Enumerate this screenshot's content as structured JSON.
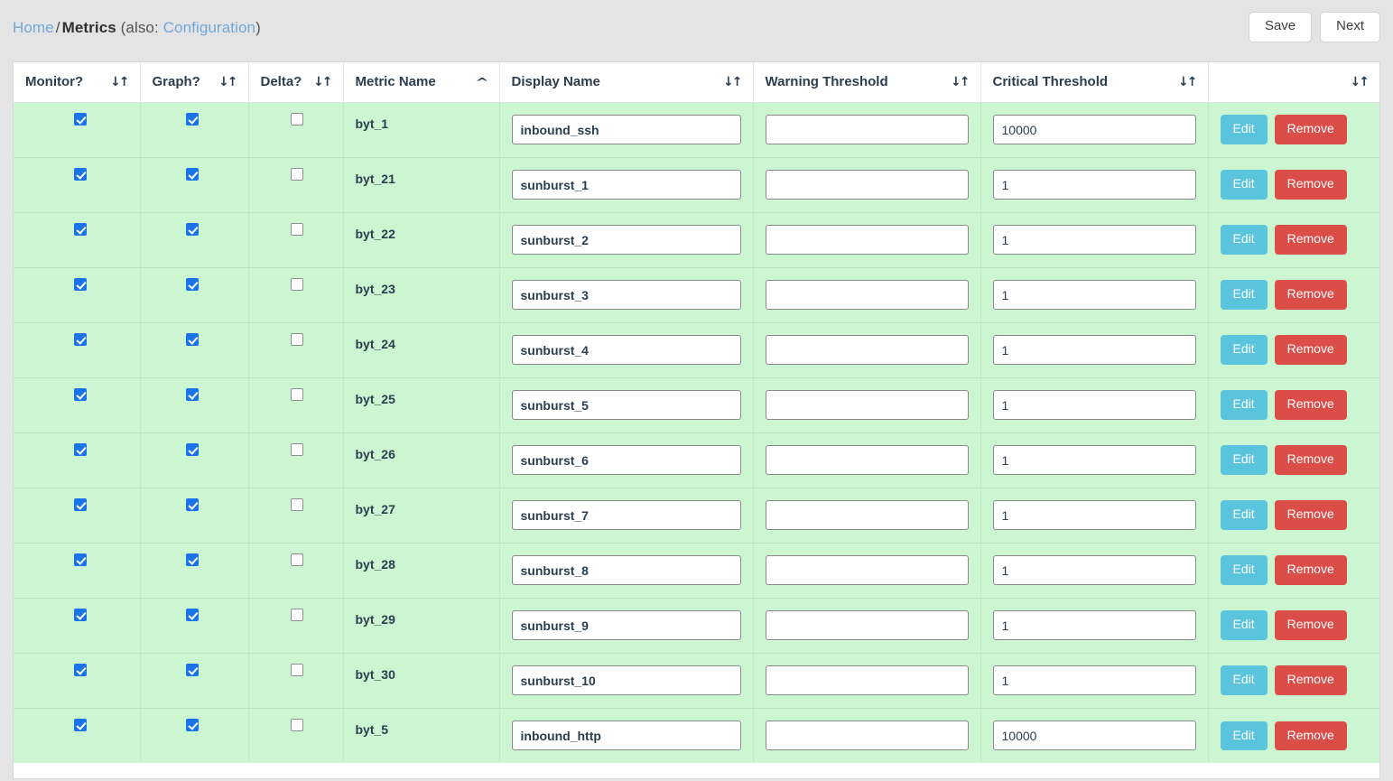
{
  "breadcrumb": {
    "home": "Home",
    "separator": "/",
    "current": "Metrics",
    "note_open": "(also:",
    "config_link": "Configuration",
    "note_close": ")"
  },
  "toolbar": {
    "save_label": "Save",
    "next_label": "Next"
  },
  "table": {
    "columns": [
      {
        "label": "Monitor?",
        "sort_icon": "↓↑",
        "sorted": false
      },
      {
        "label": "Graph?",
        "sort_icon": "↓↑",
        "sorted": false
      },
      {
        "label": "Delta?",
        "sort_icon": "↓↑",
        "sorted": false
      },
      {
        "label": "Metric Name",
        "sort_icon": "^",
        "sorted": true
      },
      {
        "label": "Display Name",
        "sort_icon": "↓↑",
        "sorted": false
      },
      {
        "label": "Warning Threshold",
        "sort_icon": "↓↑",
        "sorted": false
      },
      {
        "label": "Critical Threshold",
        "sort_icon": "↓↑",
        "sorted": false
      },
      {
        "label": "",
        "sort_icon": "↓↑",
        "sorted": false
      }
    ],
    "row_actions": {
      "edit_label": "Edit",
      "remove_label": "Remove"
    },
    "rows": [
      {
        "monitor": true,
        "graph": true,
        "delta": false,
        "metric_name": "byt_1",
        "display_name": "inbound_ssh",
        "warning": "",
        "critical": "10000"
      },
      {
        "monitor": true,
        "graph": true,
        "delta": false,
        "metric_name": "byt_21",
        "display_name": "sunburst_1",
        "warning": "",
        "critical": "1"
      },
      {
        "monitor": true,
        "graph": true,
        "delta": false,
        "metric_name": "byt_22",
        "display_name": "sunburst_2",
        "warning": "",
        "critical": "1"
      },
      {
        "monitor": true,
        "graph": true,
        "delta": false,
        "metric_name": "byt_23",
        "display_name": "sunburst_3",
        "warning": "",
        "critical": "1"
      },
      {
        "monitor": true,
        "graph": true,
        "delta": false,
        "metric_name": "byt_24",
        "display_name": "sunburst_4",
        "warning": "",
        "critical": "1"
      },
      {
        "monitor": true,
        "graph": true,
        "delta": false,
        "metric_name": "byt_25",
        "display_name": "sunburst_5",
        "warning": "",
        "critical": "1"
      },
      {
        "monitor": true,
        "graph": true,
        "delta": false,
        "metric_name": "byt_26",
        "display_name": "sunburst_6",
        "warning": "",
        "critical": "1"
      },
      {
        "monitor": true,
        "graph": true,
        "delta": false,
        "metric_name": "byt_27",
        "display_name": "sunburst_7",
        "warning": "",
        "critical": "1"
      },
      {
        "monitor": true,
        "graph": true,
        "delta": false,
        "metric_name": "byt_28",
        "display_name": "sunburst_8",
        "warning": "",
        "critical": "1"
      },
      {
        "monitor": true,
        "graph": true,
        "delta": false,
        "metric_name": "byt_29",
        "display_name": "sunburst_9",
        "warning": "",
        "critical": "1"
      },
      {
        "monitor": true,
        "graph": true,
        "delta": false,
        "metric_name": "byt_30",
        "display_name": "sunburst_10",
        "warning": "",
        "critical": "1"
      },
      {
        "monitor": true,
        "graph": true,
        "delta": false,
        "metric_name": "byt_5",
        "display_name": "inbound_http",
        "warning": "",
        "critical": "10000"
      }
    ]
  },
  "colors": {
    "page_bg": "#e4e4e4",
    "row_bg": "#ccf5d1",
    "link": "#6fa8dc",
    "header_text": "#2b3e50",
    "checkbox_checked": "#1a73e8",
    "edit_button": "#5bc4dd",
    "remove_button": "#db4d47"
  }
}
